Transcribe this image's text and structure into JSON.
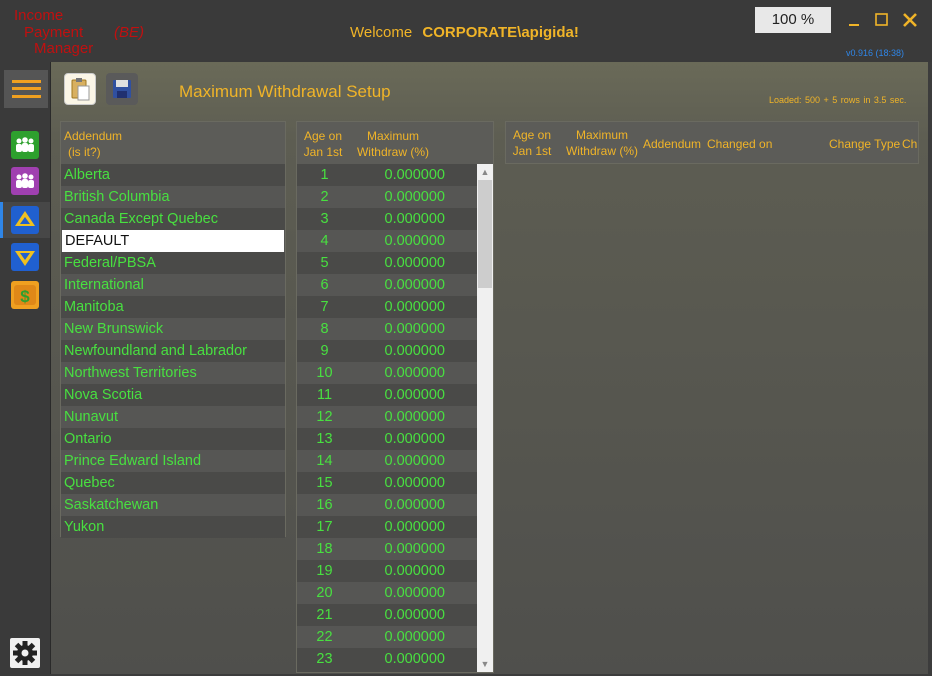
{
  "app": {
    "logo_line1": "Income",
    "logo_line2": "Payment",
    "logo_line3": "Manager",
    "logo_env": "(BE)",
    "welcome_label": "Welcome",
    "user": "CORPORATE\\apigida!",
    "zoom": "100 %",
    "version": "v0.916 (18:38)",
    "accent_color": "#f0b428",
    "value_color": "#48e040"
  },
  "toolbar": {
    "title": "Maximum Withdrawal Setup",
    "loaded": "Loaded:  500 + 5 rows in  3.5 sec."
  },
  "addendum": {
    "header_line1": "Addendum",
    "header_line2": "(is it?)",
    "items": [
      "Alberta",
      "British Columbia",
      "Canada Except Quebec",
      "DEFAULT",
      "Federal/PBSA",
      "International",
      "Manitoba",
      "New Brunswick",
      "Newfoundland and Labrador",
      "Northwest Territories",
      "Nova Scotia",
      "Nunavut",
      "Ontario",
      "Prince Edward Island",
      "Quebec",
      "Saskatchewan",
      "Yukon"
    ],
    "selected": "DEFAULT"
  },
  "age_grid": {
    "header_age_1": "Age on",
    "header_age_2": "Jan 1st",
    "header_max_1": "Maximum",
    "header_max_2": "Withdraw (%)",
    "rows": [
      {
        "age": "1",
        "pct": "0.000000"
      },
      {
        "age": "2",
        "pct": "0.000000"
      },
      {
        "age": "3",
        "pct": "0.000000"
      },
      {
        "age": "4",
        "pct": "0.000000"
      },
      {
        "age": "5",
        "pct": "0.000000"
      },
      {
        "age": "6",
        "pct": "0.000000"
      },
      {
        "age": "7",
        "pct": "0.000000"
      },
      {
        "age": "8",
        "pct": "0.000000"
      },
      {
        "age": "9",
        "pct": "0.000000"
      },
      {
        "age": "10",
        "pct": "0.000000"
      },
      {
        "age": "11",
        "pct": "0.000000"
      },
      {
        "age": "12",
        "pct": "0.000000"
      },
      {
        "age": "13",
        "pct": "0.000000"
      },
      {
        "age": "14",
        "pct": "0.000000"
      },
      {
        "age": "15",
        "pct": "0.000000"
      },
      {
        "age": "16",
        "pct": "0.000000"
      },
      {
        "age": "17",
        "pct": "0.000000"
      },
      {
        "age": "18",
        "pct": "0.000000"
      },
      {
        "age": "19",
        "pct": "0.000000"
      },
      {
        "age": "20",
        "pct": "0.000000"
      },
      {
        "age": "21",
        "pct": "0.000000"
      },
      {
        "age": "22",
        "pct": "0.000000"
      },
      {
        "age": "23",
        "pct": "0.000000"
      }
    ]
  },
  "history": {
    "col_age_1": "Age on",
    "col_age_2": "Jan 1st",
    "col_max_1": "Maximum",
    "col_max_2": "Withdraw (%)",
    "col_addendum": "Addendum",
    "col_changed_on": "Changed on",
    "col_change_type": "Change Type",
    "col_trunc": "Ch"
  },
  "icons": {
    "menu": "hamburger-menu-icon",
    "nav": [
      "people-green-icon",
      "people-purple-icon",
      "arrow-up-icon",
      "arrow-down-icon",
      "dollar-icon"
    ],
    "toolbar": [
      "clipboard-paste-icon",
      "floppy-save-icon"
    ],
    "settings": "gear-icon"
  }
}
